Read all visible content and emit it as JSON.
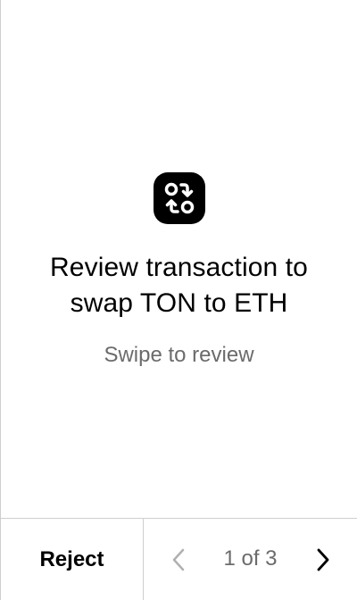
{
  "review": {
    "icon": "swap-icon",
    "title_line1": "Review transaction to",
    "title_line2": "swap TON to ETH",
    "subtitle": "Swipe to review"
  },
  "footer": {
    "reject_label": "Reject",
    "page_indicator": "1 of 3",
    "prev_icon": "chevron-left-icon",
    "next_icon": "chevron-right-icon"
  },
  "colors": {
    "text_primary": "#000000",
    "text_secondary": "#6b6b6b",
    "divider": "#cfcfcf",
    "chevron_disabled": "#b0b0b0"
  }
}
